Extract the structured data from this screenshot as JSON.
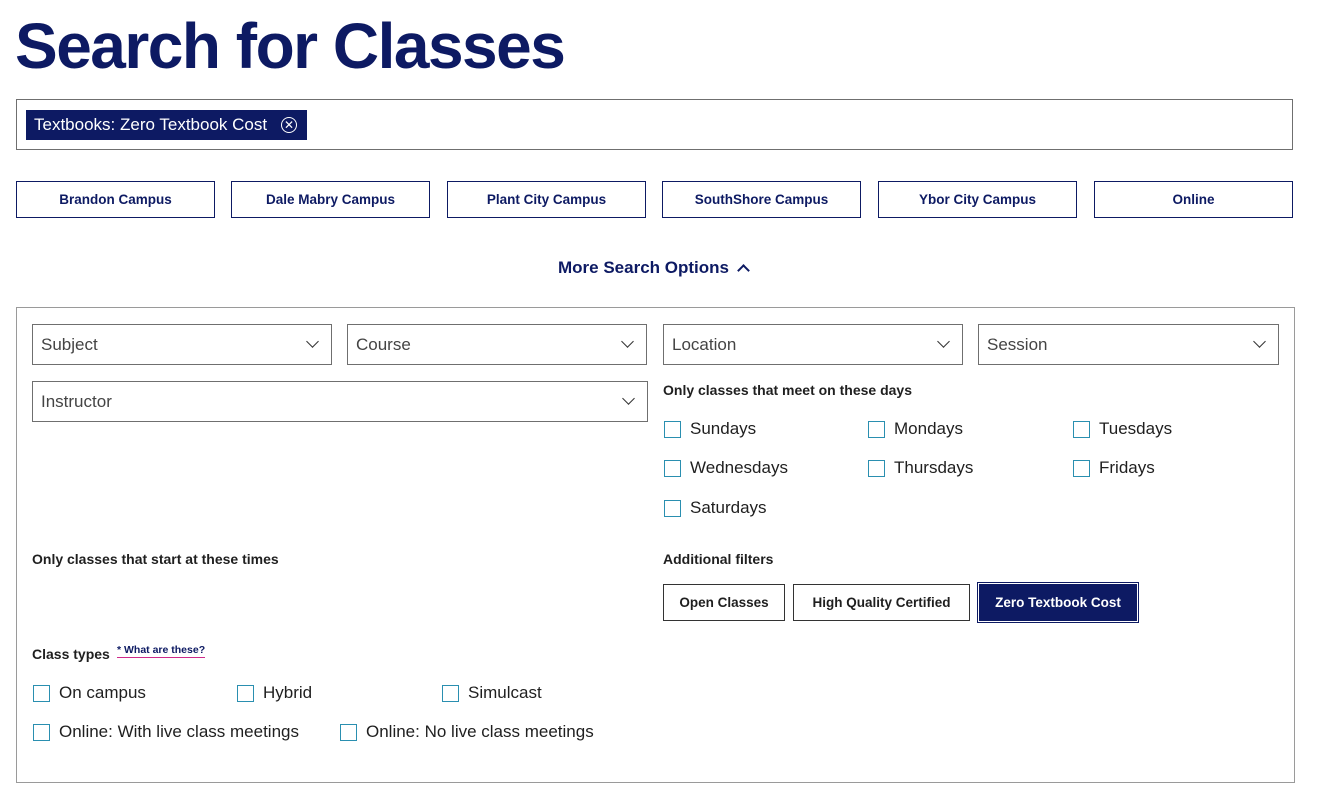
{
  "page": {
    "title": "Search for Classes"
  },
  "search": {
    "chip_label": "Textbooks: Zero Textbook Cost",
    "chip_remove_icon": "circle-x-icon"
  },
  "campuses": [
    "Brandon Campus",
    "Dale Mabry Campus",
    "Plant City Campus",
    "SouthShore Campus",
    "Ybor City Campus",
    "Online"
  ],
  "more_options": {
    "label": "More Search Options",
    "icon": "chevron-up-icon",
    "expanded": true
  },
  "selects": {
    "subject": "Subject",
    "course": "Course",
    "location": "Location",
    "session": "Session",
    "instructor": "Instructor"
  },
  "days": {
    "label": "Only classes that meet on these days",
    "items": [
      "Sundays",
      "Mondays",
      "Tuesdays",
      "Wednesdays",
      "Thursdays",
      "Fridays",
      "Saturdays"
    ]
  },
  "times": {
    "label": "Only classes that start at these times"
  },
  "additional_filters": {
    "label": "Additional filters",
    "buttons": [
      "Open Classes",
      "High Quality Certified",
      "Zero Textbook Cost"
    ],
    "active": "Zero Textbook Cost"
  },
  "class_types": {
    "label": "Class types",
    "help_link": "* What are these?",
    "items": [
      "On campus",
      "Hybrid",
      "Simulcast",
      "Online: With live class meetings",
      "Online: No live class meetings"
    ]
  },
  "colors": {
    "brand": "#0d1a63",
    "checkbox": "#2a8fb0",
    "link_underline": "#d02a8a"
  }
}
